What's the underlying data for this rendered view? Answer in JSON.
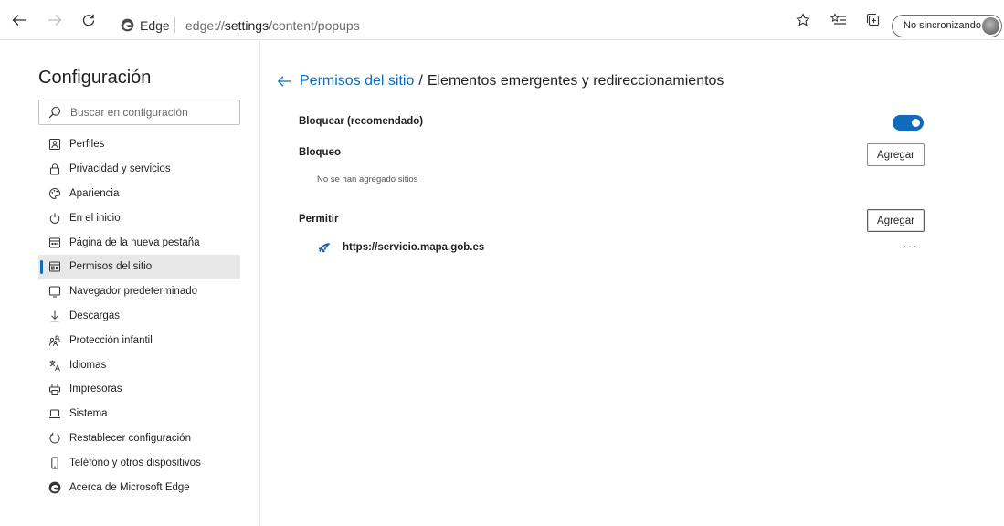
{
  "browser": {
    "brand": "Edge",
    "url_prefix": "edge://",
    "url_main": "settings",
    "url_suffix": "/content/popups",
    "profile_label": "No sincronizando"
  },
  "sidebar": {
    "title": "Configuración",
    "search_placeholder": "Buscar en configuración",
    "items": [
      {
        "label": "Perfiles",
        "icon": "profile-icon",
        "active": false
      },
      {
        "label": "Privacidad y servicios",
        "icon": "lock-icon",
        "active": false
      },
      {
        "label": "Apariencia",
        "icon": "palette-icon",
        "active": false
      },
      {
        "label": "En el inicio",
        "icon": "power-icon",
        "active": false
      },
      {
        "label": "Página de la nueva pestaña",
        "icon": "new-tab-icon",
        "active": false
      },
      {
        "label": "Permisos del sitio",
        "icon": "site-permissions-icon",
        "active": true
      },
      {
        "label": "Navegador predeterminado",
        "icon": "browser-window-icon",
        "active": false
      },
      {
        "label": "Descargas",
        "icon": "download-icon",
        "active": false
      },
      {
        "label": "Protección infantil",
        "icon": "family-icon",
        "active": false
      },
      {
        "label": "Idiomas",
        "icon": "language-icon",
        "active": false
      },
      {
        "label": "Impresoras",
        "icon": "printer-icon",
        "active": false
      },
      {
        "label": "Sistema",
        "icon": "laptop-icon",
        "active": false
      },
      {
        "label": "Restablecer configuración",
        "icon": "reset-icon",
        "active": false
      },
      {
        "label": "Teléfono y otros dispositivos",
        "icon": "phone-icon",
        "active": false
      },
      {
        "label": "Acerca de Microsoft Edge",
        "icon": "edge-logo-icon",
        "active": false
      }
    ]
  },
  "main": {
    "breadcrumb_link": "Permisos del sitio",
    "breadcrumb_sep": "/",
    "breadcrumb_current": "Elementos emergentes y redireccionamientos",
    "block_toggle_label": "Bloquear (recomendado)",
    "block_toggle_on": true,
    "block_section": "Bloqueo",
    "block_empty": "No se han agregado sitios",
    "add_label": "Agregar",
    "allow_section": "Permitir",
    "allow_sites": [
      {
        "url": "https://servicio.mapa.gob.es",
        "menu": "···"
      }
    ]
  },
  "colors": {
    "accent": "#0f6cbd"
  }
}
